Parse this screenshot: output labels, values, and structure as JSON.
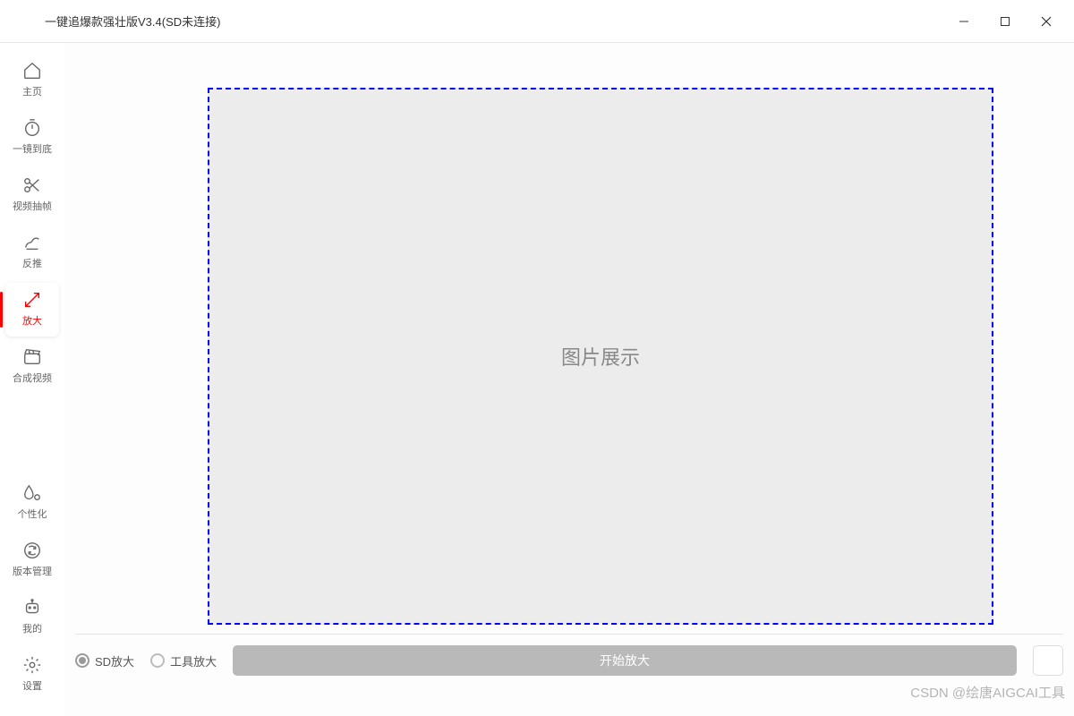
{
  "window": {
    "title": "一键追爆款强壮版V3.4(SD未连接)"
  },
  "sidebar": {
    "top_items": [
      {
        "id": "home",
        "label": "主页",
        "icon": "home-icon"
      },
      {
        "id": "oneshot",
        "label": "一镜到底",
        "icon": "timer-icon"
      },
      {
        "id": "extract",
        "label": "视频抽帧",
        "icon": "scissors-icon"
      },
      {
        "id": "reverse",
        "label": "反推",
        "icon": "scribble-icon"
      },
      {
        "id": "enlarge",
        "label": "放大",
        "icon": "expand-icon",
        "active": true
      },
      {
        "id": "compose",
        "label": "合成视频",
        "icon": "clapper-icon"
      }
    ],
    "bottom_items": [
      {
        "id": "personalize",
        "label": "个性化",
        "icon": "drop-icon"
      },
      {
        "id": "version",
        "label": "版本管理",
        "icon": "refresh-icon"
      },
      {
        "id": "mine",
        "label": "我的",
        "icon": "robot-icon"
      },
      {
        "id": "settings",
        "label": "设置",
        "icon": "gear-icon"
      }
    ]
  },
  "main": {
    "dropzone_text": "图片展示"
  },
  "bottom": {
    "radio_sd": "SD放大",
    "radio_tool": "工具放大",
    "start_button": "开始放大",
    "selected_radio": "sd"
  },
  "watermark": "CSDN @绘唐AIGCAI工具"
}
